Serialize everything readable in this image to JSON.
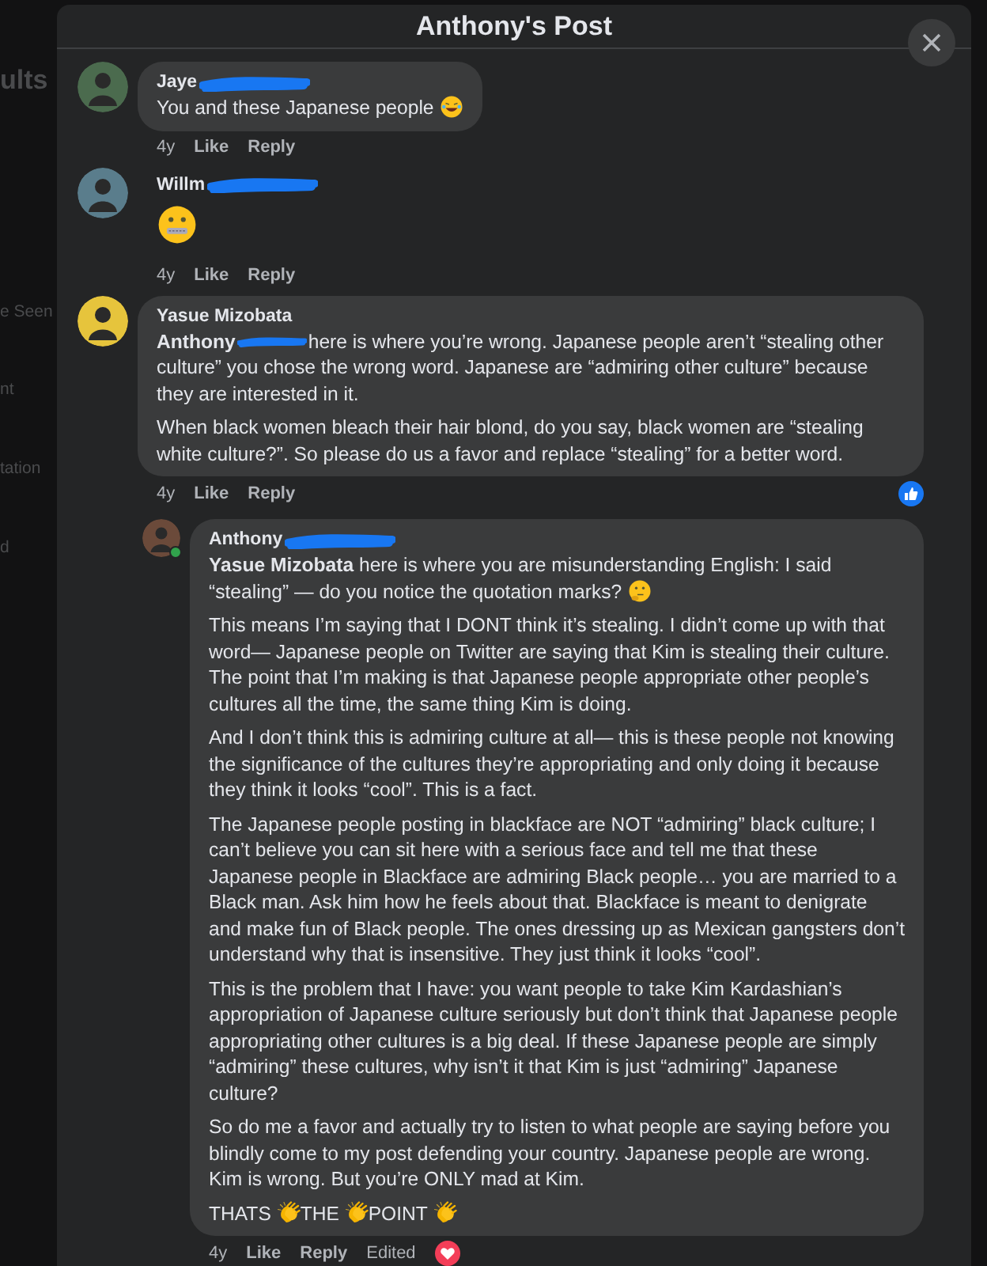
{
  "background": {
    "texts": [
      "ults",
      "e Seen",
      "nt",
      "tation",
      "d"
    ]
  },
  "dialog": {
    "title": "Anthony's Post"
  },
  "comments": [
    {
      "author": "Jaye",
      "author_redacted": true,
      "online": false,
      "paragraphs": [
        [
          {
            "kind": "text",
            "text": "You and these Japanese people "
          },
          {
            "kind": "laugh"
          }
        ]
      ],
      "time": "4y",
      "like": "Like",
      "reply": "Reply"
    },
    {
      "author": "Willm",
      "author_redacted": true,
      "online": false,
      "paragraphs": [
        [
          {
            "kind": "zipper"
          }
        ]
      ],
      "time": "4y",
      "like": "Like",
      "reply": "Reply"
    },
    {
      "author": "Yasue Mizobata",
      "author_redacted": false,
      "online": false,
      "paragraphs": [
        [
          {
            "kind": "mention",
            "text": "Anthony"
          },
          {
            "kind": "redaction"
          },
          {
            "kind": "text",
            "text": "here is where you’re wrong. Japanese people aren’t “stealing other culture” you chose the wrong word. Japanese are “admiring other culture” because they are interested in it."
          }
        ],
        [
          {
            "kind": "text",
            "text": "When black women bleach their hair blond, do you say, black women are “stealing white culture?”. So please do us a favor and replace “stealing” for a better word."
          }
        ]
      ],
      "time": "4y",
      "like": "Like",
      "reply": "Reply",
      "like_reaction": true,
      "replies": [
        {
          "author": "Anthony",
          "author_redacted": true,
          "online": true,
          "paragraphs": [
            [
              {
                "kind": "mention",
                "text": "Yasue Mizobata"
              },
              {
                "kind": "text",
                "text": " here is where you are misunderstanding English: I said “stealing” — do you notice the quotation marks? "
              },
              {
                "kind": "thinking"
              }
            ],
            [
              {
                "kind": "text",
                "text": "This means I’m saying that I DONT think it’s stealing. I didn’t come up with that word— Japanese people on Twitter are saying that Kim is stealing their culture. The point that I’m making is that Japanese people appropriate other people’s cultures all the time, the same thing Kim is doing."
              }
            ],
            [
              {
                "kind": "text",
                "text": "And I don’t think this is admiring culture at all— this is these people not knowing the significance of the cultures they’re appropriating and only doing it because they think it looks “cool”. This is a fact."
              }
            ],
            [
              {
                "kind": "text",
                "text": "The Japanese people posting in blackface are NOT “admiring” black culture; I can’t believe you can sit here with a serious face and tell me that these Japanese people in Blackface are admiring Black people… you are married to a Black man. Ask him how he feels about that. Blackface is meant to denigrate and make fun of Black people. The ones dressing up as Mexican gangsters don’t understand why that is insensitive. They just think it looks “cool”."
              }
            ],
            [
              {
                "kind": "text",
                "text": "This is the problem that I have: you want people to take Kim Kardashian’s appropriation of Japanese culture seriously but don’t think that Japanese people appropriating other cultures is a big deal. If these Japanese people are simply “admiring” these cultures, why isn’t it that Kim is just “admiring” Japanese culture?"
              }
            ],
            [
              {
                "kind": "text",
                "text": "So do me a favor and actually try to listen to what people are saying before you blindly come to my post defending your country. Japanese people are wrong. Kim is wrong. But you’re ONLY mad at Kim."
              }
            ],
            [
              {
                "kind": "text",
                "text": "THATS "
              },
              {
                "kind": "clap"
              },
              {
                "kind": "text",
                "text": "THE "
              },
              {
                "kind": "clap"
              },
              {
                "kind": "text",
                "text": "POINT "
              },
              {
                "kind": "clap"
              }
            ]
          ],
          "time": "4y",
          "like": "Like",
          "reply": "Reply",
          "edited_label": "Edited",
          "love_reaction": true
        }
      ]
    }
  ]
}
